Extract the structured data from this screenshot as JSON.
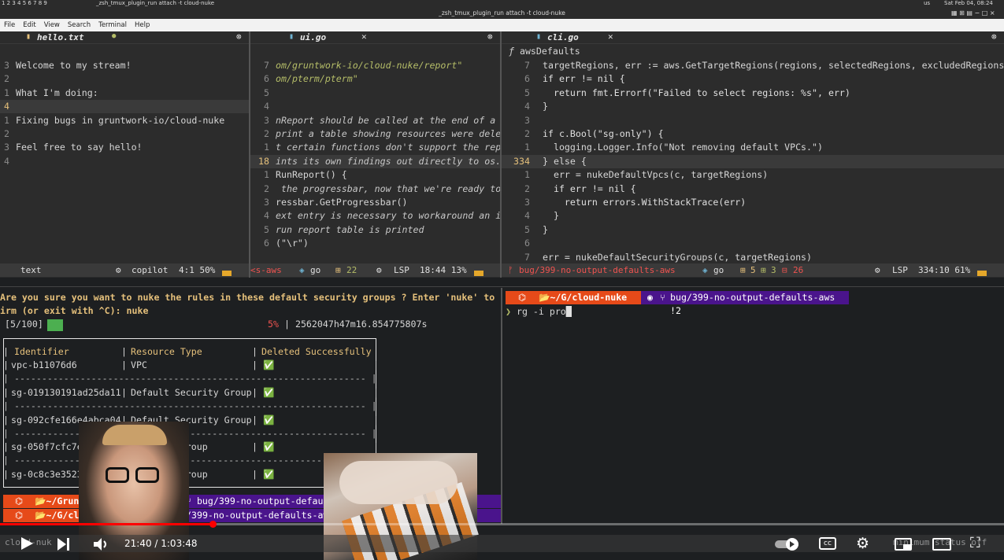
{
  "system_bar": {
    "workspaces": "1 2 3 4 5 6 7 8 9",
    "title_left": "_zsh_tmux_plugin_run attach -t cloud-nuke",
    "clock": "Sat Feb 04, 08:24",
    "locale": "us"
  },
  "window_title": "_zsh_tmux_plugin_run attach -t cloud-nuke",
  "menu": [
    "File",
    "Edit",
    "View",
    "Search",
    "Terminal",
    "Help"
  ],
  "pane1": {
    "tab": "hello.txt",
    "lines": [
      {
        "n": "3",
        "t": "Welcome to my stream!"
      },
      {
        "n": "2",
        "t": ""
      },
      {
        "n": "1",
        "t": "What I'm doing:"
      },
      {
        "n": "4",
        "t": ""
      },
      {
        "n": "1",
        "t": "Fixing bugs in gruntwork-io/cloud-nuke"
      },
      {
        "n": "2",
        "t": ""
      },
      {
        "n": "3",
        "t": "Feel free to say hello!"
      },
      {
        "n": "4",
        "t": ""
      }
    ],
    "status_mode": "text",
    "status_copilot": "copilot",
    "status_pos": "4:1 50%"
  },
  "pane2": {
    "tab": "ui.go",
    "lines": [
      {
        "n": "7",
        "t": "om/gruntwork-io/cloud-nuke/report\""
      },
      {
        "n": "6",
        "t": "om/pterm/pterm\""
      },
      {
        "n": "5",
        "t": ""
      },
      {
        "n": "4",
        "t": ""
      },
      {
        "n": "3",
        "t": "nReport should be called at the end of a"
      },
      {
        "n": "2",
        "t": "print a table showing resources were dele"
      },
      {
        "n": "1",
        "t": "t certain functions don't support the rep"
      },
      {
        "n": "18",
        "t": "ints its own findings out directly to os."
      },
      {
        "n": "1",
        "t": "RunReport() {"
      },
      {
        "n": "2",
        "t": " the progressbar, now that we're ready to"
      },
      {
        "n": "3",
        "t": "ressbar.GetProgressbar()"
      },
      {
        "n": "4",
        "t": "ext entry is necessary to workaround an i"
      },
      {
        "n": "5",
        "t": "run report table is printed"
      },
      {
        "n": "6",
        "t": "(\"\\r\")"
      }
    ],
    "status_branch": "<s-aws",
    "status_lang": "go",
    "status_count": "22",
    "status_lsp": "LSP",
    "status_pos": "18:44 13%"
  },
  "pane3": {
    "tab": "cli.go",
    "breadcrumb": "awsDefaults",
    "lines": [
      {
        "n": "7",
        "t": "targetRegions, err := aws.GetTargetRegions(regions, selectedRegions, excludedRegions)"
      },
      {
        "n": "6",
        "t": "if err != nil {"
      },
      {
        "n": "5",
        "t": "  return fmt.Errorf(\"Failed to select regions: %s\", err)"
      },
      {
        "n": "4",
        "t": "}"
      },
      {
        "n": "3",
        "t": ""
      },
      {
        "n": "2",
        "t": "if c.Bool(\"sg-only\") {"
      },
      {
        "n": "1",
        "t": "  logging.Logger.Info(\"Not removing default VPCs.\")"
      },
      {
        "n": "334",
        "t": "} else {"
      },
      {
        "n": "1",
        "t": "  err = nukeDefaultVpcs(c, targetRegions)"
      },
      {
        "n": "2",
        "t": "  if err != nil {"
      },
      {
        "n": "3",
        "t": "    return errors.WithStackTrace(err)"
      },
      {
        "n": "4",
        "t": "  }"
      },
      {
        "n": "5",
        "t": "}"
      },
      {
        "n": "6",
        "t": ""
      },
      {
        "n": "7",
        "t": "err = nukeDefaultSecurityGroups(c, targetRegions)"
      }
    ],
    "status_branch": "bug/399-no-output-defaults-aws",
    "status_lang": "go",
    "status_a": "5",
    "status_b": "3",
    "status_c": "26",
    "status_lsp": "LSP",
    "status_pos": "334:10 61%"
  },
  "term_left": {
    "prompt_line1": "Are you sure you want to nuke the rules in these default security groups ? Enter 'nuke' to conf",
    "prompt_line2": "irm (or exit with ^C): nuke",
    "progress": "[5/100]",
    "percent": "5%",
    "elapsed": "| 2562047h47m16.854775807s",
    "table_headers": [
      "Identifier",
      "Resource Type",
      "Deleted Successfully"
    ],
    "rows": [
      {
        "id": "vpc-b11076d6",
        "type": "VPC",
        "ok": "✅"
      },
      {
        "id": "sg-019130191ad25da11",
        "type": "Default Security Group",
        "ok": "✅"
      },
      {
        "id": "sg-092cfe166e4abca04",
        "type": "Default Security Group",
        "ok": "✅"
      },
      {
        "id": "sg-050f7cfc7e01c8",
        "type": "Security Group",
        "ok": "✅"
      },
      {
        "id": "sg-0c8c3e3523fa26a",
        "type": "Security Group",
        "ok": "✅"
      }
    ],
    "prompt_dir1": "~/Gruntwork",
    "prompt_dir2": "~/G/cloud-nu",
    "prompt_branch1": "bug/399-no-output-defau",
    "prompt_branch2": "/399-no-output-defaults-aws",
    "bottom_tab": "cloud-nuk"
  },
  "term_right": {
    "dir": "~/G/cloud-nuke",
    "branch": "bug/399-no-output-defaults-aws !2",
    "command": "rg -i pro",
    "bottom_text": "minimum status off"
  },
  "video": {
    "time": "21:40 / 1:03:48",
    "progress_fraction": 0.34
  }
}
